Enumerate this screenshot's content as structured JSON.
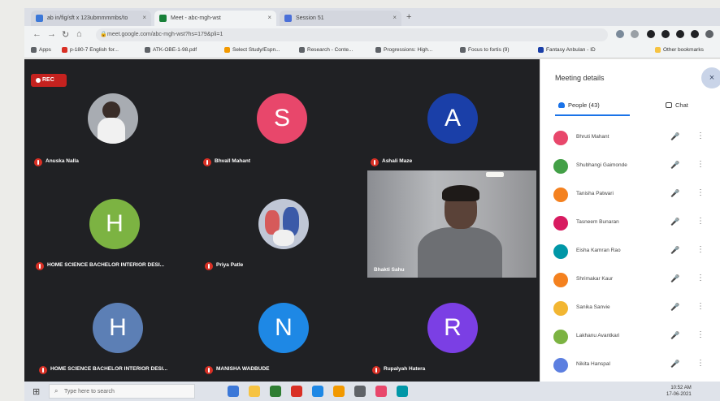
{
  "browser": {
    "tabs": [
      {
        "title": "ab in/fig/sft x 123ubmmmmbs/to",
        "close": "×",
        "favicon_color": "#3c78d8"
      },
      {
        "title": "Meet - abc-mgh-wst",
        "close": "×",
        "favicon_color": "#188038"
      },
      {
        "title": "Session 51",
        "close": "×",
        "favicon_color": "#4a6fd8"
      }
    ],
    "new_tab": "+",
    "back": "←",
    "forward": "→",
    "reload": "↻",
    "home": "⌂",
    "url": "meet.google.com/abc-mgh-wst?hs=179&pli=1",
    "lock": "🔒",
    "bookmarks": [
      {
        "label": "Apps",
        "color": "#5f6368"
      },
      {
        "label": "p-180-7 English for...",
        "color": "#d93025"
      },
      {
        "label": "ATK-OBE-1-98.pdf",
        "color": "#5f6368"
      },
      {
        "label": "Select Study/Espn...",
        "color": "#f29900"
      },
      {
        "label": "Research - Conte...",
        "color": "#5f6368"
      },
      {
        "label": "Progressions: High...",
        "color": "#5f6368"
      },
      {
        "label": "Focus to fortis (9)",
        "color": "#5f6368"
      },
      {
        "label": "Fantasy Anbulan - ID",
        "color": "#1a3fa8"
      },
      {
        "label": "Other bookmarks",
        "color": "#f6c342"
      }
    ]
  },
  "meeting": {
    "rec_label": "REC",
    "tiles": [
      {
        "name": "Anuska Nalla",
        "initial": "",
        "color": "#9e9e9e",
        "photo": true
      },
      {
        "name": "Bhvall Mahant",
        "initial": "S",
        "color": "#e8476b"
      },
      {
        "name": "Ashali Maze",
        "initial": "A",
        "color": "#1a3fa8"
      },
      {
        "name": "HOME SCIENCE BACHELOR INTERIOR DESI...",
        "initial": "H",
        "color": "#7cb342"
      },
      {
        "name": "Priya Patle",
        "initial": "",
        "color": "#c0c7d6",
        "photo": true
      },
      {
        "name": "Bhakti Sahu",
        "initial": "",
        "color": "#8e9196",
        "video": true
      },
      {
        "name": "HOME SCIENCE BACHELOR INTERIOR DESI...",
        "initial": "H",
        "color": "#5c7fb5"
      },
      {
        "name": "MANISHA WADBUDE",
        "initial": "N",
        "color": "#1e88e5"
      },
      {
        "name": "Rupalyah Hatera",
        "initial": "R",
        "color": "#7b3fe4"
      }
    ]
  },
  "panel": {
    "title": "Meeting details",
    "close_icon": "×",
    "tab_people": "People (43)",
    "tab_chat": "Chat",
    "participants": [
      {
        "name": "Bhruti Mahant",
        "color": "#e8476b"
      },
      {
        "name": "Shubhangi Gaimonde",
        "color": "#43a047"
      },
      {
        "name": "Tanisha Patwari",
        "color": "#f4811f"
      },
      {
        "name": "Tasneem Bunaran",
        "color": "#d81b60"
      },
      {
        "name": "Eisha Kamran Rao",
        "color": "#0097a7"
      },
      {
        "name": "Shrimakar Kaur",
        "color": "#f4811f"
      },
      {
        "name": "Sanika Sanvie",
        "color": "#f2b632"
      },
      {
        "name": "Lakhanu Avantkari",
        "color": "#7cb342"
      },
      {
        "name": "Nikita Hanspal",
        "color": "#5c7fe0"
      }
    ],
    "mic_icon": "🎤",
    "more_icon": "⋮"
  },
  "taskbar": {
    "start_icon": "⊞",
    "search_placeholder": "Type here to search",
    "search_icon": "⌕",
    "time": "10:52 AM",
    "date": "17-06-2021",
    "apps": [
      "#3c78d8",
      "#f6c342",
      "#2e7d32",
      "#d93025",
      "#1e88e5",
      "#f29900",
      "#5f6368",
      "#e8476b",
      "#0097a7"
    ]
  }
}
